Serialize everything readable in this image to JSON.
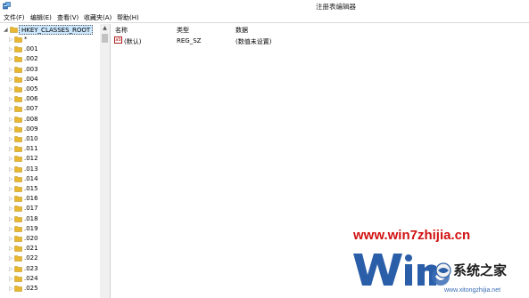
{
  "window": {
    "title": "注册表编辑器",
    "app_icon": "regedit-icon"
  },
  "menu": [
    {
      "label": "文件(F)"
    },
    {
      "label": "编辑(E)"
    },
    {
      "label": "查看(V)"
    },
    {
      "label": "收藏夹(A)"
    },
    {
      "label": "帮助(H)"
    }
  ],
  "tree": {
    "root": {
      "label": "HKEY_CLASSES_ROOT",
      "expanded": true,
      "selected": true
    },
    "items": [
      {
        "label": "*"
      },
      {
        "label": ".001"
      },
      {
        "label": ".002"
      },
      {
        "label": ".003"
      },
      {
        "label": ".004"
      },
      {
        "label": ".005"
      },
      {
        "label": ".006"
      },
      {
        "label": ".007"
      },
      {
        "label": ".008"
      },
      {
        "label": ".009"
      },
      {
        "label": ".010"
      },
      {
        "label": ".011"
      },
      {
        "label": ".012"
      },
      {
        "label": ".013"
      },
      {
        "label": ".014"
      },
      {
        "label": ".015"
      },
      {
        "label": ".016"
      },
      {
        "label": ".017"
      },
      {
        "label": ".018"
      },
      {
        "label": ".019"
      },
      {
        "label": ".020"
      },
      {
        "label": ".021"
      },
      {
        "label": ".022"
      },
      {
        "label": ".023"
      },
      {
        "label": ".024"
      },
      {
        "label": ".025"
      }
    ]
  },
  "list": {
    "columns": {
      "name": "名称",
      "type": "类型",
      "data": "数据"
    },
    "rows": [
      {
        "icon": "ab",
        "name": "(默认)",
        "type": "REG_SZ",
        "data": "(数值未设置)"
      }
    ]
  },
  "watermark": {
    "url": "www.win7zhijia.cn",
    "site_name": "系统之家",
    "sub_url": "www.xitongzhijia.net",
    "colors": {
      "url": "#d21212",
      "logo": "#2a5ea8"
    }
  },
  "colors": {
    "folder": "#e8b830",
    "selection": "#cce8ff",
    "divider": "#cfcfcf"
  }
}
